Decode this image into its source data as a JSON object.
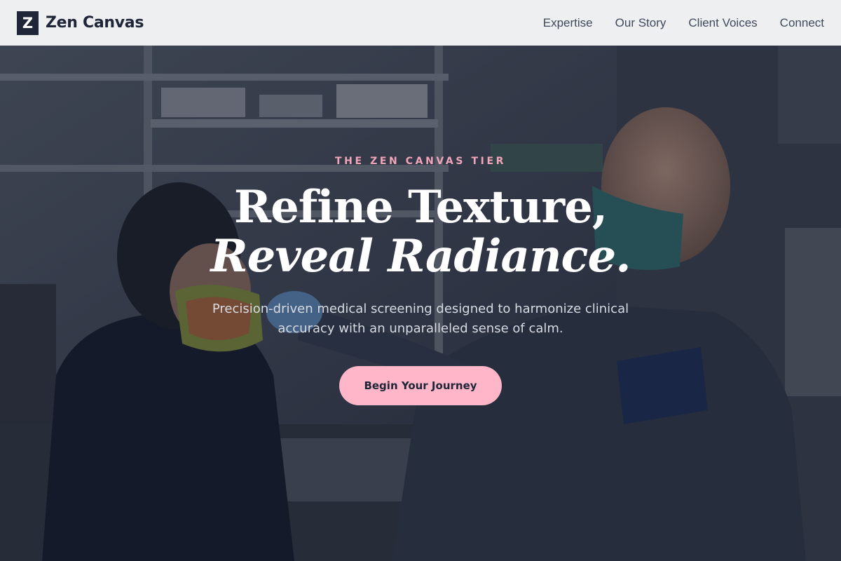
{
  "brand": {
    "mark": "Z",
    "name": "Zen Canvas"
  },
  "nav": {
    "items": [
      {
        "label": "Expertise"
      },
      {
        "label": "Our Story"
      },
      {
        "label": "Client Voices"
      },
      {
        "label": "Connect"
      }
    ]
  },
  "hero": {
    "eyebrow": "THE ZEN CANVAS TIER",
    "headline_line1": "Refine Texture,",
    "headline_line2": "Reveal Radiance.",
    "subtext": "Precision-driven medical screening designed to harmonize clinical accuracy with an unparalleled sense of calm.",
    "cta_label": "Begin Your Journey"
  },
  "colors": {
    "header_bg": "#eeeff1",
    "brand_dark": "#1e2638",
    "accent_pink": "#ffb6c8",
    "eyebrow_pink": "#f0a6b8",
    "hero_overlay": "#181e2e"
  }
}
